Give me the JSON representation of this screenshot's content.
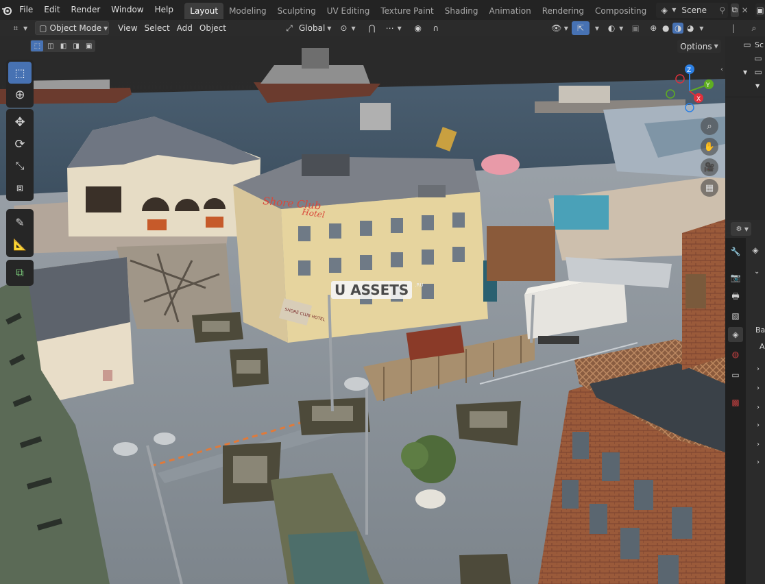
{
  "topbar": {
    "menus": [
      "File",
      "Edit",
      "Render",
      "Window",
      "Help"
    ],
    "workspaces": [
      "Layout",
      "Modeling",
      "Sculpting",
      "UV Editing",
      "Texture Paint",
      "Shading",
      "Animation",
      "Rendering",
      "Compositing"
    ],
    "active_workspace": "Layout",
    "scene_name": "Scene"
  },
  "header": {
    "mode": "Object Mode",
    "menus": [
      "View",
      "Select",
      "Add",
      "Object"
    ],
    "transform_orientation": "Global",
    "options_label": "Options"
  },
  "gizmo": {
    "x": "X",
    "y": "Y",
    "z": "Z"
  },
  "viewport": {
    "watermark": "U ASSETS",
    "watermark_suffix": ".RU",
    "signs": {
      "hotel_roof": "Shore Club",
      "hotel_roof2": "Hotel",
      "hotel_front": "SHORE CLUB HOTEL"
    }
  },
  "right_panel": {
    "outliner_label": "Sc",
    "props_text_1": "Ba",
    "props_text_2": "A"
  },
  "colors": {
    "active_blue": "#4772b3",
    "axis_x": "#e0303b",
    "axis_y": "#5fae21",
    "axis_z": "#2c80e5"
  }
}
